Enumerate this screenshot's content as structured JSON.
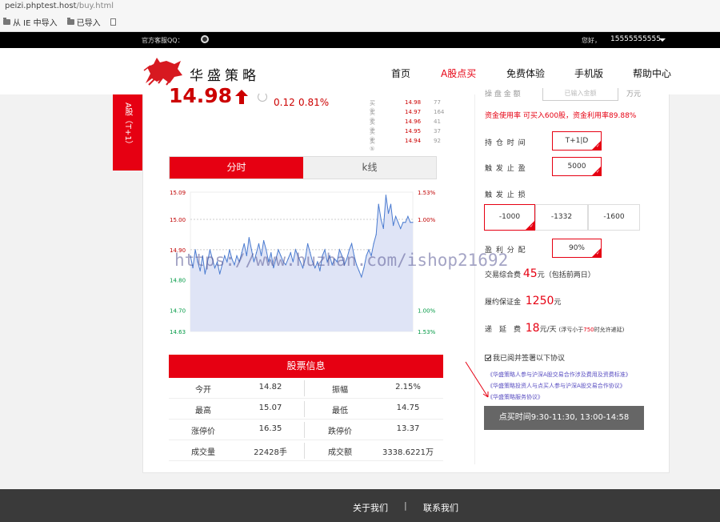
{
  "browser": {
    "url_host": "peizi.phptest.host",
    "url_path": "/buy.html",
    "bookmarks": [
      {
        "label": "从 IE 中导入",
        "icon": "folder-icon"
      },
      {
        "label": "已导入",
        "icon": "folder-icon"
      },
      {
        "label": "",
        "icon": "page-icon"
      }
    ]
  },
  "topbar": {
    "qq_label": "官方客服QQ：",
    "greeting": "您好，",
    "phone": "15555555555"
  },
  "header": {
    "logo_text": "华盛策略",
    "nav": [
      {
        "label": "首页",
        "active": false
      },
      {
        "label": "A股点买",
        "active": true
      },
      {
        "label": "免费体验",
        "active": false
      },
      {
        "label": "手机版",
        "active": false
      },
      {
        "label": "帮助中心",
        "active": false
      }
    ]
  },
  "side_tab": "A股（T+1）",
  "quote": {
    "price": "14.98",
    "change": "0.12",
    "percent": "0.81%",
    "bids": [
      {
        "label": "买①",
        "price": "14.98",
        "vol": "77"
      },
      {
        "label": "买②",
        "price": "14.97",
        "vol": "164"
      },
      {
        "label": "买③",
        "price": "14.96",
        "vol": "41"
      },
      {
        "label": "买④",
        "price": "14.95",
        "vol": "37"
      },
      {
        "label": "买⑤",
        "price": "14.94",
        "vol": "92"
      }
    ]
  },
  "tabs": {
    "intraday": "分时",
    "kline": "k线"
  },
  "chart_data": {
    "type": "area",
    "y_left_ticks": [
      "15.09",
      "15.00",
      "14.90",
      "14.80",
      "14.70",
      "14.63"
    ],
    "y_right_ticks": [
      "1.53%",
      "1.00%",
      "1.00%",
      "1.53%"
    ],
    "ylim": [
      14.63,
      15.09
    ],
    "colors": {
      "line": "#4a7bd0",
      "fill": "#dfe4f6",
      "up": "#c00000",
      "down": "#009944"
    },
    "values": [
      14.88,
      14.84,
      14.9,
      14.86,
      14.83,
      14.88,
      14.82,
      14.86,
      14.9,
      14.87,
      14.84,
      14.86,
      14.82,
      14.85,
      14.88,
      14.86,
      14.9,
      14.87,
      14.85,
      14.88,
      14.86,
      14.89,
      14.92,
      14.88,
      14.94,
      14.9,
      14.86,
      14.89,
      14.92,
      14.88,
      14.93,
      14.9,
      14.86,
      14.89,
      14.84,
      14.87,
      14.9,
      14.88,
      14.86,
      14.85,
      14.87,
      14.89,
      14.86,
      14.9,
      14.88,
      14.86,
      14.84,
      14.87,
      14.92,
      14.89,
      14.86,
      14.84,
      14.86,
      14.83,
      14.88,
      14.9,
      14.86,
      14.88,
      14.85,
      14.87,
      14.86,
      14.9,
      14.88,
      14.85,
      14.87,
      14.9,
      14.92,
      14.88,
      14.85,
      14.83,
      14.81,
      14.84,
      14.88,
      14.9,
      14.88,
      14.92,
      14.95,
      15.05,
      15.0,
      14.97,
      15.08,
      15.02,
      15.05,
      14.98,
      15.01,
      14.99,
      14.97,
      14.99,
      14.99,
      15.01,
      14.99,
      14.99
    ]
  },
  "stock_info": {
    "title": "股票信息",
    "rows": [
      {
        "k1": "今开",
        "v1": "14.82",
        "k2": "振幅",
        "v2": "2.15%"
      },
      {
        "k1": "最高",
        "v1": "15.07",
        "k2": "最低",
        "v2": "14.75"
      },
      {
        "k1": "涨停价",
        "v1": "16.35",
        "k2": "跌停价",
        "v2": "13.37"
      },
      {
        "k1": "成交量",
        "v1": "22428手",
        "k2": "成交额",
        "v2": "3338.6221万"
      }
    ]
  },
  "order": {
    "amount_label": "操 盘 金 额",
    "amount_placeholder": "已输入金额",
    "amount_unit": "万元",
    "usage_text": "资金使用率 可买入600股，资金利用率89.88%",
    "hold_label": "持 仓 时 间",
    "hold_value": "T+1|D",
    "take_profit_label": "触 发 止 盈",
    "take_profit_value": "5000",
    "stop_loss_label": "触 发 止 损",
    "stop_loss_options": [
      "-1000",
      "-1332",
      "-1600"
    ],
    "profit_split_label": "盈 利 分 配",
    "profit_split_value": "90%",
    "fee_label": "交易综合费",
    "fee_value": "45",
    "fee_unit": "元（包括前两日）",
    "deposit_label": "履约保证金",
    "deposit_value": "1250",
    "deposit_unit": "元",
    "delay_label": "递　延　费",
    "delay_value": "18",
    "delay_unit": "元/天",
    "delay_note_pre": "(浮亏小于",
    "delay_note_num": "750",
    "delay_note_post": "时允许递延)",
    "agree_text": "我已阅并签署以下协议",
    "agreements": [
      "《华盛策略人参与沪深A股交易合作涉及费用及资费标准》",
      "《华盛策略投资人与点买人参与沪深A股交易合作协议》",
      "《华盛策略服务协议》"
    ],
    "trade_button": "点买时间9:30-11:30, 13:00-14:58"
  },
  "watermark": "https://www.huzhan.com/ishop21692",
  "footer": {
    "about": "关于我们",
    "separator": "|",
    "contact": "联系我们"
  }
}
